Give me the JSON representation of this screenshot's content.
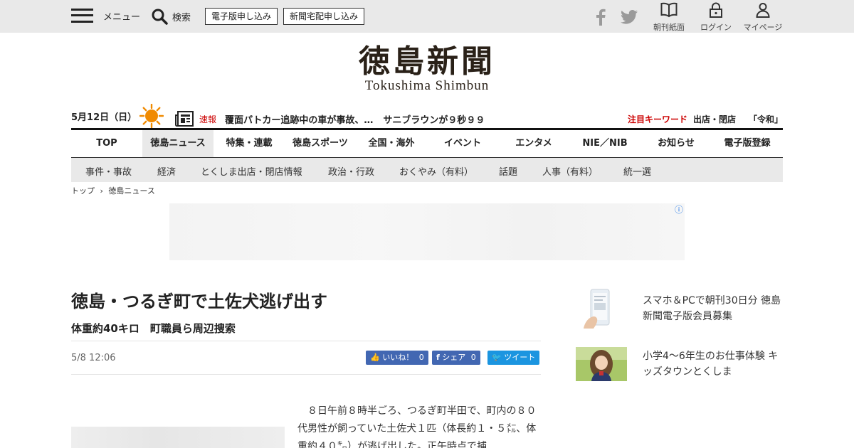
{
  "topbar": {
    "menu_label": "メニュー",
    "search_label": "検索",
    "digital_apply": "電子版申し込み",
    "delivery_apply": "新聞宅配申し込み",
    "util_paper": "朝刊紙面",
    "util_login": "ログイン",
    "util_mypage": "マイページ"
  },
  "masthead": {
    "logo_jp": "徳島新聞",
    "logo_en": "Tokushima Shimbun"
  },
  "ticker": {
    "date": "5月12日（日）",
    "weather_icon": "sun-icon",
    "breaking_label": "速報",
    "headline_1": "覆面パトカー追跡中の車が事故、…",
    "headline_2": "サニブラウンが９秒９９",
    "keyword_label": "注目キーワード",
    "keyword_1": "出店・閉店",
    "keyword_2": "「令和」"
  },
  "main_nav": [
    {
      "label": "TOP",
      "active": false
    },
    {
      "label": "徳島ニュース",
      "active": true
    },
    {
      "label": "特集・連載",
      "active": false
    },
    {
      "label": "徳島スポーツ",
      "active": false
    },
    {
      "label": "全国・海外",
      "active": false
    },
    {
      "label": "イベント",
      "active": false
    },
    {
      "label": "エンタメ",
      "active": false
    },
    {
      "label": "NIE／NIB",
      "active": false
    },
    {
      "label": "お知らせ",
      "active": false
    },
    {
      "label": "電子版登録",
      "active": false
    }
  ],
  "sub_nav": [
    "事件・事故",
    "経済",
    "とくしま出店・閉店情報",
    "政治・行政",
    "おくやみ（有料）",
    "話題",
    "人事（有料）",
    "統一選"
  ],
  "breadcrumb": {
    "home": "トップ",
    "current": "徳島ニュース"
  },
  "ad": {
    "info_icon": "ⓘ"
  },
  "article": {
    "title": "徳島・つるぎ町で土佐犬逃げ出す",
    "subtitle": "体重約40キロ　町職員ら周辺捜索",
    "published": "5/8 12:06",
    "like_label": "いいね！",
    "like_count": "0",
    "share_label": "シェア",
    "share_count": "0",
    "tweet_label": "ツイート",
    "body": "８日午前８時半ごろ、つるぎ町半田で、町内の８０代男性が飼っていた土佐犬１匹（体長約１・５㍍、体重約４０㌔）が逃げ出した。正午時点で捕"
  },
  "sidebar": [
    {
      "text": "スマホ＆PCで朝刊30日分 徳島新聞電子版会員募集",
      "thumb": "phone-reader-thumbnail"
    },
    {
      "text": "小学4～6年生のお仕事体験 キッズタウンとくしま",
      "thumb": "child-photo-thumbnail"
    }
  ],
  "colors": {
    "topbar_bg": "#e9e9e9",
    "accent_red": "#cc0000",
    "sun_orange": "#f08a00",
    "facebook": "#4267b2",
    "twitter": "#1b95e0"
  }
}
